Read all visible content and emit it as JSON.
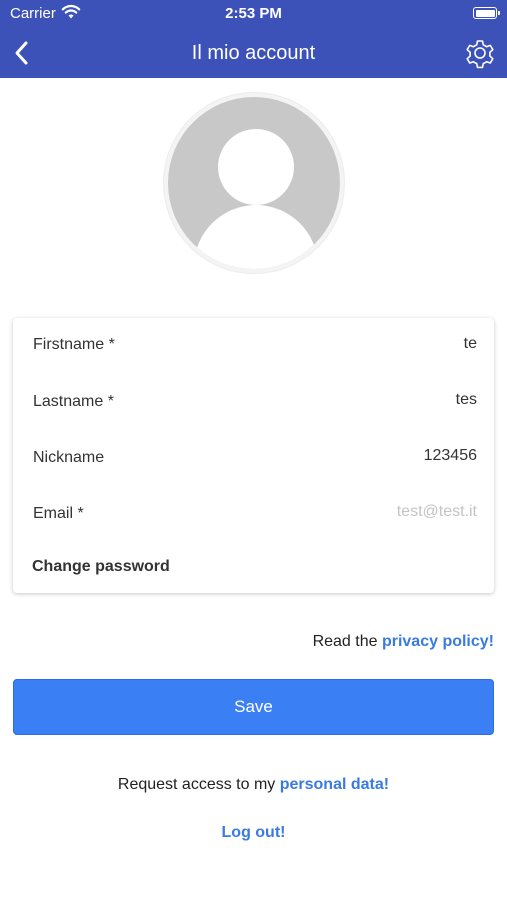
{
  "status_bar": {
    "carrier": "Carrier",
    "time": "2:53 PM",
    "battery_level": 1.0
  },
  "nav": {
    "title": "Il mio account",
    "back_icon": "chevron-left-icon",
    "settings_icon": "gear-icon",
    "background": "#3d52b8"
  },
  "profile": {
    "avatar_icon": "default-user-avatar-icon"
  },
  "form": {
    "fields": [
      {
        "label": "Firstname *",
        "value": "te"
      },
      {
        "label": "Lastname *",
        "value": "tes"
      },
      {
        "label": "Nickname",
        "value": "123456"
      },
      {
        "label": "Email *",
        "value": "test@test.it"
      }
    ],
    "change_password_label": "Change password"
  },
  "privacy": {
    "prefix": "Read the ",
    "link": "privacy policy!"
  },
  "actions": {
    "save_label": "Save",
    "request_prefix": "Request access to my ",
    "request_link": "personal data!",
    "logout_label": "Log out!"
  },
  "colors": {
    "primary": "#3a80f4",
    "link": "#3a7be0",
    "header": "#3d52b8"
  }
}
